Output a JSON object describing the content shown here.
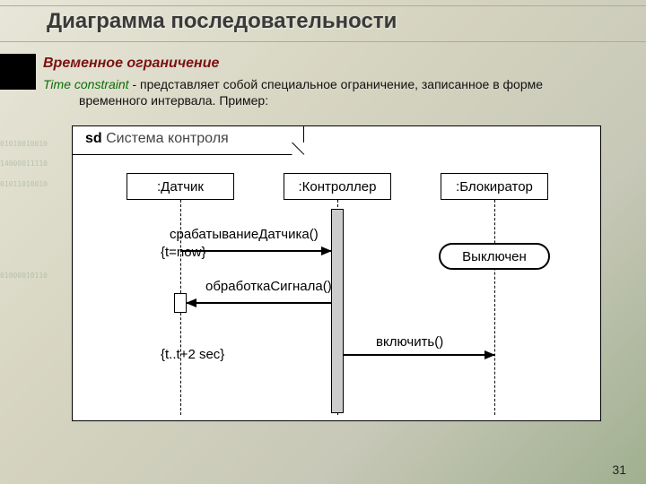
{
  "title": "Диаграмма последовательности",
  "subhead": "Временное ограничение",
  "term": "Time constraint",
  "desc_line1": " - представляет собой специальное ограничение, записанное в форме",
  "desc_line2": "временного интервала. Пример:",
  "frame": {
    "kind": "sd",
    "name": "Система контроля"
  },
  "lifelines": {
    "l1": ":Датчик",
    "l2": ":Контроллер",
    "l3": ":Блокиратор"
  },
  "messages": {
    "m1": "срабатываниеДатчика()",
    "m2": "обработкаСигнала()",
    "m3": "включить()"
  },
  "constraints": {
    "c1": "{t=now}",
    "c2": "{t..t+2 sec}"
  },
  "state": "Выключен",
  "bg_digits": [
    "01010010010",
    "14000011110",
    "01011010010",
    "01000010110"
  ],
  "page": "31"
}
